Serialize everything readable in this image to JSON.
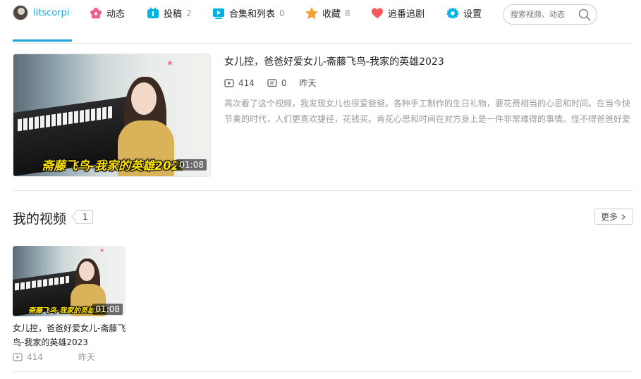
{
  "user": {
    "name": "litscorpi"
  },
  "nav": {
    "items": [
      {
        "label": "动态",
        "count": ""
      },
      {
        "label": "投稿",
        "count": "2"
      },
      {
        "label": "合集和列表",
        "count": "0"
      },
      {
        "label": "收藏",
        "count": "8"
      },
      {
        "label": "追番追剧",
        "count": ""
      },
      {
        "label": "设置",
        "count": ""
      }
    ],
    "search_placeholder": "搜索视频、动态"
  },
  "colors": {
    "accent": "#1aa3d6",
    "text": "#222222",
    "muted": "#999999",
    "caption": "#ffe300"
  },
  "featured": {
    "title": "女儿控，爸爸好爱女儿-斋藤飞鸟-我家的英雄2023",
    "plays": "414",
    "comments": "0",
    "date": "昨天",
    "duration": "01:08",
    "thumb_caption": "斋藤飞鸟-我家的英雄2023",
    "description": "再次看了这个视频，我发现女儿也很爱爸爸。各种手工制作的生日礼物，要花费相当的心思和时间。在当今快节奏的时代，人们更喜欢捷径，花钱买。肯花心思和时间在对方身上是一件非常难得的事情。怪不得爸爸好爱"
  },
  "my_videos": {
    "title": "我的视频",
    "count": "1",
    "more_label": "更多",
    "items": [
      {
        "title": "女儿控，爸爸好爱女儿-斋藤飞鸟-我家的英雄2023",
        "plays": "414",
        "date": "昨天",
        "duration": "01:08",
        "thumb_caption": "斋藤飞鸟-我家的英雄2023"
      }
    ]
  }
}
